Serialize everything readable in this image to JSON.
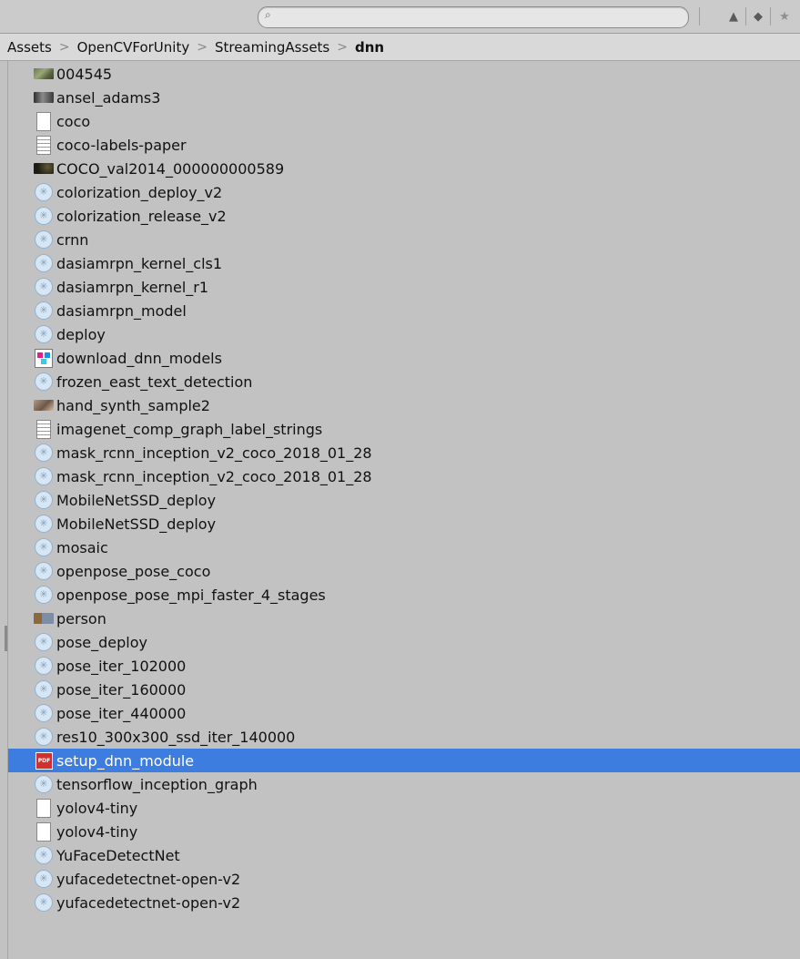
{
  "search": {
    "placeholder": ""
  },
  "toolbar": {
    "icons": [
      "scene-filter-icon",
      "label-filter-icon",
      "favorite-star-icon"
    ]
  },
  "breadcrumb": [
    "Assets",
    "OpenCVForUnity",
    "StreamingAssets",
    "dnn"
  ],
  "files": [
    {
      "name": "004545",
      "icon": "texture-icon"
    },
    {
      "name": "ansel_adams3",
      "icon": "texture-icon"
    },
    {
      "name": "coco",
      "icon": "blank-file-icon"
    },
    {
      "name": "coco-labels-paper",
      "icon": "text-file-icon"
    },
    {
      "name": "COCO_val2014_000000000589",
      "icon": "texture-icon"
    },
    {
      "name": "colorization_deploy_v2",
      "icon": "model-asset-icon"
    },
    {
      "name": "colorization_release_v2",
      "icon": "model-asset-icon"
    },
    {
      "name": "crnn",
      "icon": "model-asset-icon"
    },
    {
      "name": "dasiamrpn_kernel_cls1",
      "icon": "model-asset-icon"
    },
    {
      "name": "dasiamrpn_kernel_r1",
      "icon": "model-asset-icon"
    },
    {
      "name": "dasiamrpn_model",
      "icon": "model-asset-icon"
    },
    {
      "name": "deploy",
      "icon": "model-asset-icon"
    },
    {
      "name": "download_dnn_models",
      "icon": "script-icon"
    },
    {
      "name": "frozen_east_text_detection",
      "icon": "model-asset-icon"
    },
    {
      "name": "hand_synth_sample2",
      "icon": "texture-icon"
    },
    {
      "name": "imagenet_comp_graph_label_strings",
      "icon": "text-file-icon"
    },
    {
      "name": "mask_rcnn_inception_v2_coco_2018_01_28",
      "icon": "model-asset-icon"
    },
    {
      "name": "mask_rcnn_inception_v2_coco_2018_01_28",
      "icon": "model-asset-icon"
    },
    {
      "name": "MobileNetSSD_deploy",
      "icon": "model-asset-icon"
    },
    {
      "name": "MobileNetSSD_deploy",
      "icon": "model-asset-icon"
    },
    {
      "name": "mosaic",
      "icon": "model-asset-icon"
    },
    {
      "name": "openpose_pose_coco",
      "icon": "model-asset-icon"
    },
    {
      "name": "openpose_pose_mpi_faster_4_stages",
      "icon": "model-asset-icon"
    },
    {
      "name": "person",
      "icon": "texture-icon"
    },
    {
      "name": "pose_deploy",
      "icon": "model-asset-icon"
    },
    {
      "name": "pose_iter_102000",
      "icon": "model-asset-icon"
    },
    {
      "name": "pose_iter_160000",
      "icon": "model-asset-icon"
    },
    {
      "name": "pose_iter_440000",
      "icon": "model-asset-icon"
    },
    {
      "name": "res10_300x300_ssd_iter_140000",
      "icon": "model-asset-icon"
    },
    {
      "name": "setup_dnn_module",
      "icon": "pdf-icon",
      "selected": true
    },
    {
      "name": "tensorflow_inception_graph",
      "icon": "model-asset-icon"
    },
    {
      "name": "yolov4-tiny",
      "icon": "blank-file-icon"
    },
    {
      "name": "yolov4-tiny",
      "icon": "blank-file-icon"
    },
    {
      "name": "YuFaceDetectNet",
      "icon": "model-asset-icon"
    },
    {
      "name": "yufacedetectnet-open-v2",
      "icon": "model-asset-icon"
    },
    {
      "name": "yufacedetectnet-open-v2",
      "icon": "model-asset-icon"
    }
  ],
  "colors": {
    "selection": "#3e7de0",
    "panel_background": "#c2c2c2",
    "breadcrumb_background": "#d9d9d9"
  }
}
